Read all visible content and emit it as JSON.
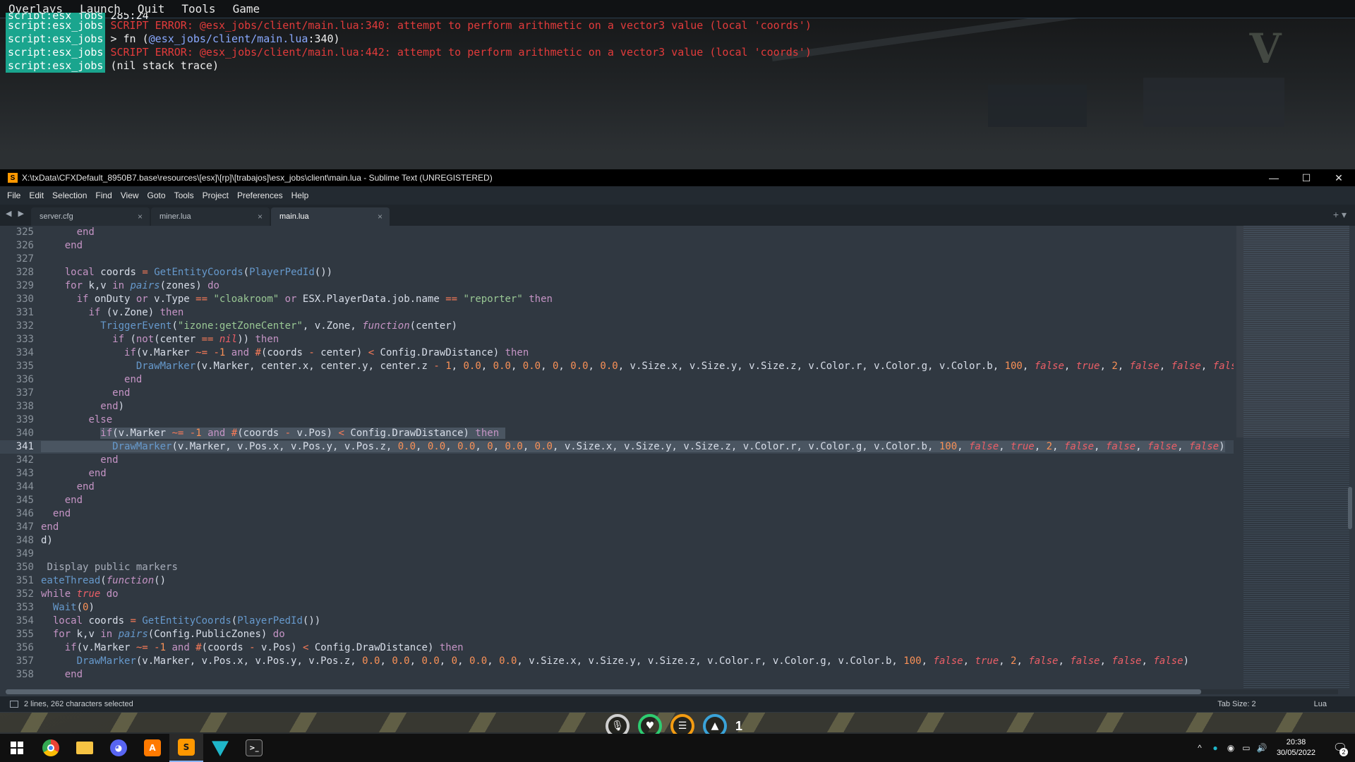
{
  "console": {
    "menu": [
      "Overlays",
      "Launch",
      "Quit",
      "Tools",
      "Game"
    ],
    "cut_tag": "script:esx_jobs",
    "cut_text": "285:24",
    "log": [
      {
        "tag": "script:esx_jobs",
        "type": "error",
        "text": "SCRIPT ERROR: @esx_jobs/client/main.lua:340: attempt to perform arithmetic on a vector3 value (local 'coords')"
      },
      {
        "tag": "script:esx_jobs",
        "type": "trace",
        "prefix": "> fn (",
        "link": "@esx_jobs/client/main.lua",
        "suffix": ":340)"
      },
      {
        "tag": "script:esx_jobs",
        "type": "error",
        "text": "SCRIPT ERROR: @esx_jobs/client/main.lua:442: attempt to perform arithmetic on a vector3 value (local 'coords')"
      },
      {
        "tag": "script:esx_jobs",
        "type": "plain",
        "text": "(nil stack trace)"
      }
    ],
    "logo": "V"
  },
  "window": {
    "title": "X:\\txData\\CFXDefault_8950B7.base\\resources\\[esx]\\[rp]\\[trabajos]\\esx_jobs\\client\\main.lua - Sublime Text (UNREGISTERED)",
    "minimize": "—",
    "maximize": "☐",
    "close": "✕"
  },
  "menu": [
    "File",
    "Edit",
    "Selection",
    "Find",
    "View",
    "Goto",
    "Tools",
    "Project",
    "Preferences",
    "Help"
  ],
  "tabs": [
    {
      "label": "server.cfg",
      "active": false
    },
    {
      "label": "miner.lua",
      "active": false
    },
    {
      "label": "main.lua",
      "active": true
    }
  ],
  "tab_nav": "◀ ▶",
  "tab_right": "+ ▾",
  "editor": {
    "first_line": 325,
    "current_line": 341
  },
  "status": {
    "selection": "2 lines, 262 characters selected",
    "tab_size": "Tab Size: 2",
    "syntax": "Lua"
  },
  "hud": {
    "count": "1"
  },
  "taskbar": {
    "apps": [
      "start",
      "chrome",
      "file-explorer",
      "discord",
      "avast",
      "sublime-text",
      "vpn",
      "terminal"
    ],
    "time": "20:38",
    "date": "30/05/2022",
    "notifications": "2"
  }
}
